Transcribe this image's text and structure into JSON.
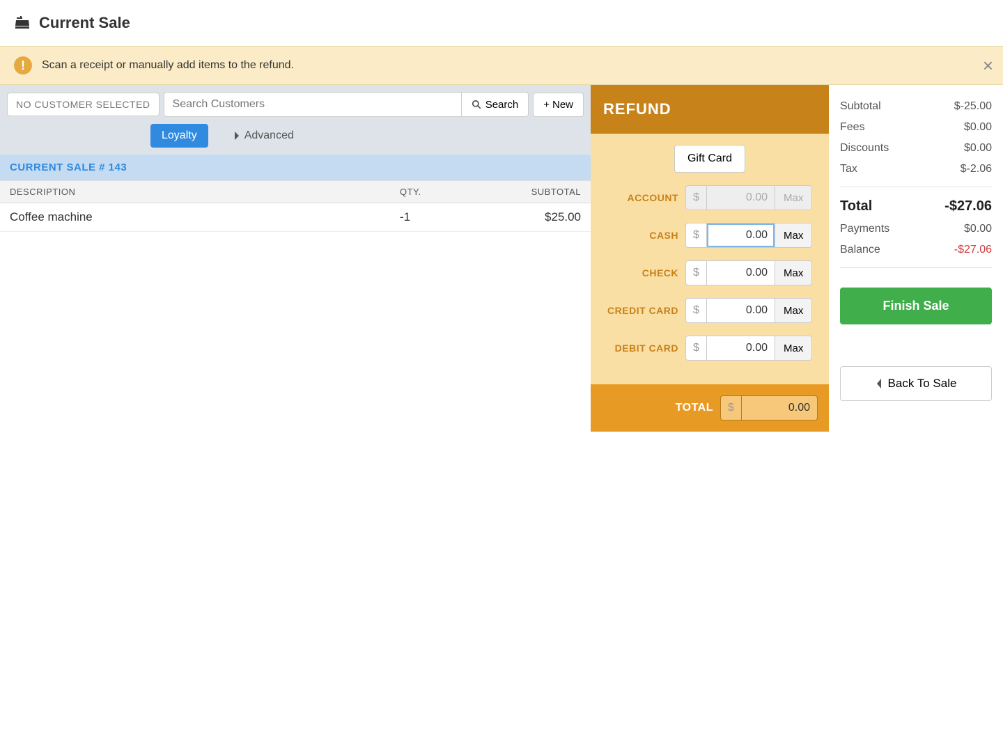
{
  "header": {
    "title": "Current Sale"
  },
  "alert": {
    "text": "Scan a receipt or manually add items to the refund."
  },
  "customer": {
    "no_customer_label": "NO CUSTOMER SELECTED",
    "search_placeholder": "Search Customers",
    "search_btn": "Search",
    "new_btn": "New",
    "tab_loyalty": "Loyalty",
    "tab_advanced": "Advanced"
  },
  "sale": {
    "title": "CURRENT SALE # 143",
    "columns": {
      "desc": "DESCRIPTION",
      "qty": "QTY.",
      "subtotal": "SUBTOTAL"
    },
    "rows": [
      {
        "desc": "Coffee machine",
        "qty": "-1",
        "subtotal": "$25.00"
      }
    ]
  },
  "refund": {
    "title": "REFUND",
    "gift_card": "Gift Card",
    "currency": "$",
    "max_label": "Max",
    "methods": {
      "account": {
        "label": "ACCOUNT",
        "value": "0.00",
        "disabled": true
      },
      "cash": {
        "label": "CASH",
        "value": "0.00",
        "focused": true
      },
      "check": {
        "label": "CHECK",
        "value": "0.00"
      },
      "credit": {
        "label": "CREDIT CARD",
        "value": "0.00"
      },
      "debit": {
        "label": "DEBIT CARD",
        "value": "0.00"
      }
    },
    "total": {
      "label": "TOTAL",
      "value": "0.00"
    }
  },
  "summary": {
    "subtotal": {
      "label": "Subtotal",
      "value": "$-25.00"
    },
    "fees": {
      "label": "Fees",
      "value": "$0.00"
    },
    "discounts": {
      "label": "Discounts",
      "value": "$0.00"
    },
    "tax": {
      "label": "Tax",
      "value": "$-2.06"
    },
    "total": {
      "label": "Total",
      "value": "-$27.06"
    },
    "payments": {
      "label": "Payments",
      "value": "$0.00"
    },
    "balance": {
      "label": "Balance",
      "value": "-$27.06"
    },
    "finish_btn": "Finish Sale",
    "back_btn": "Back To Sale"
  }
}
